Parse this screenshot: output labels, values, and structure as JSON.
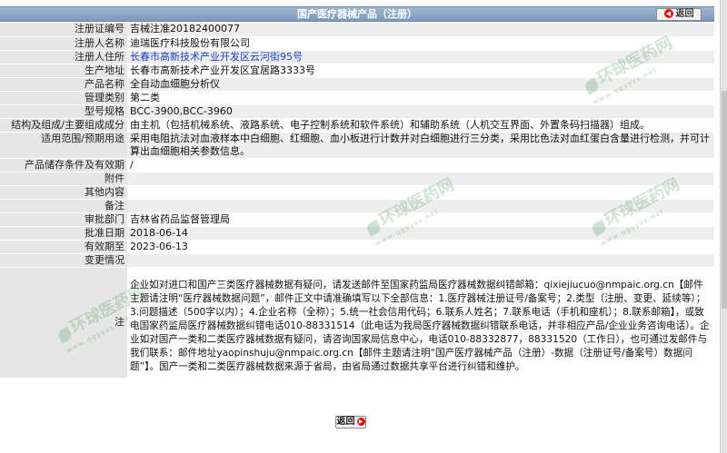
{
  "header": {
    "title": "国产医疗器械产品（注册）",
    "back_label": "返回"
  },
  "rows": [
    {
      "label": "注册证编号",
      "value": "吉械注准20182400077"
    },
    {
      "label": "注册人名称",
      "value": "迪瑞医疗科技股份有限公司"
    },
    {
      "label": "注册人住所",
      "value": "长春市高新技术产业开发区云河街95号"
    },
    {
      "label": "生产地址",
      "value": "长春市高新技术产业开发区宜居路3333号"
    },
    {
      "label": "产品名称",
      "value": "全自动血细胞分析仪"
    },
    {
      "label": "管理类别",
      "value": "第二类"
    },
    {
      "label": "型号规格",
      "value": "BCC-3900,BCC-3960"
    },
    {
      "label": "结构及组成/主要组成成分",
      "value": "由主机（包括机械系统、液路系统、电子控制系统和软件系统）和辅助系统（人机交互界面、外置条码扫描器）组成。"
    },
    {
      "label": "适用范围/预期用途",
      "value": "采用电阻抗法对血液样本中白细胞、红细胞、血小板进行计数并对白细胞进行三分类，采用比色法对血红蛋白含量进行检测，并可计算出血细胞相关参数信息。"
    },
    {
      "label": "产品储存条件及有效期",
      "value": "/"
    },
    {
      "label": "附件",
      "value": ""
    },
    {
      "label": "其他内容",
      "value": ""
    },
    {
      "label": "备注",
      "value": ""
    },
    {
      "label": "审批部门",
      "value": "吉林省药品监督管理局"
    },
    {
      "label": "批准日期",
      "value": "2018-06-14"
    },
    {
      "label": "有效期至",
      "value": "2023-06-13"
    },
    {
      "label": "变更情况",
      "value": ""
    }
  ],
  "note": {
    "label": "注",
    "text": "企业如对进口和国产三类医疗器械数据有疑问，请发送邮件至国家药监局医疗器械数据纠错邮箱：qixiejiucuo@nmpaic.org.cn【邮件主题请注明“医疗器械数据问题”，邮件正文中请准确填写以下全部信息：1.医疗器械注册证号/备案号；2.类型（注册、变更、延续等）；3.问题描述（500字以内）；4.企业名称（全称）；5.统一社会信用代码；6.联系人姓名；7.联系电话（手机和座机）；8.联系邮箱】，或致电国家药监局医疗器械数据纠错电话010-88331514（此电话为我局医疗器械数据纠错联系电话，并非相应产品/企业业务咨询电话）。企业如对国产一类和二类医疗器械数据有疑问，请咨询国家局信息中心，电话010-88332877，88331520（工作日），也可通过发邮件与我们联系：邮件地址yaopinshuju@nmpaic.org.cn【邮件主题请注明“国产医疗器械产品（注册）-数据（注册证号/备案号）数据问题”】。国产一类和二类医疗器械数据来源于省局，由省局通过数据共享平台进行纠错和维护。"
  },
  "footer": {
    "back_label": "返回"
  },
  "watermark": {
    "text": "环球医药网",
    "sub": "www.qgyyzs.net",
    "color": "#2e8b3b"
  }
}
